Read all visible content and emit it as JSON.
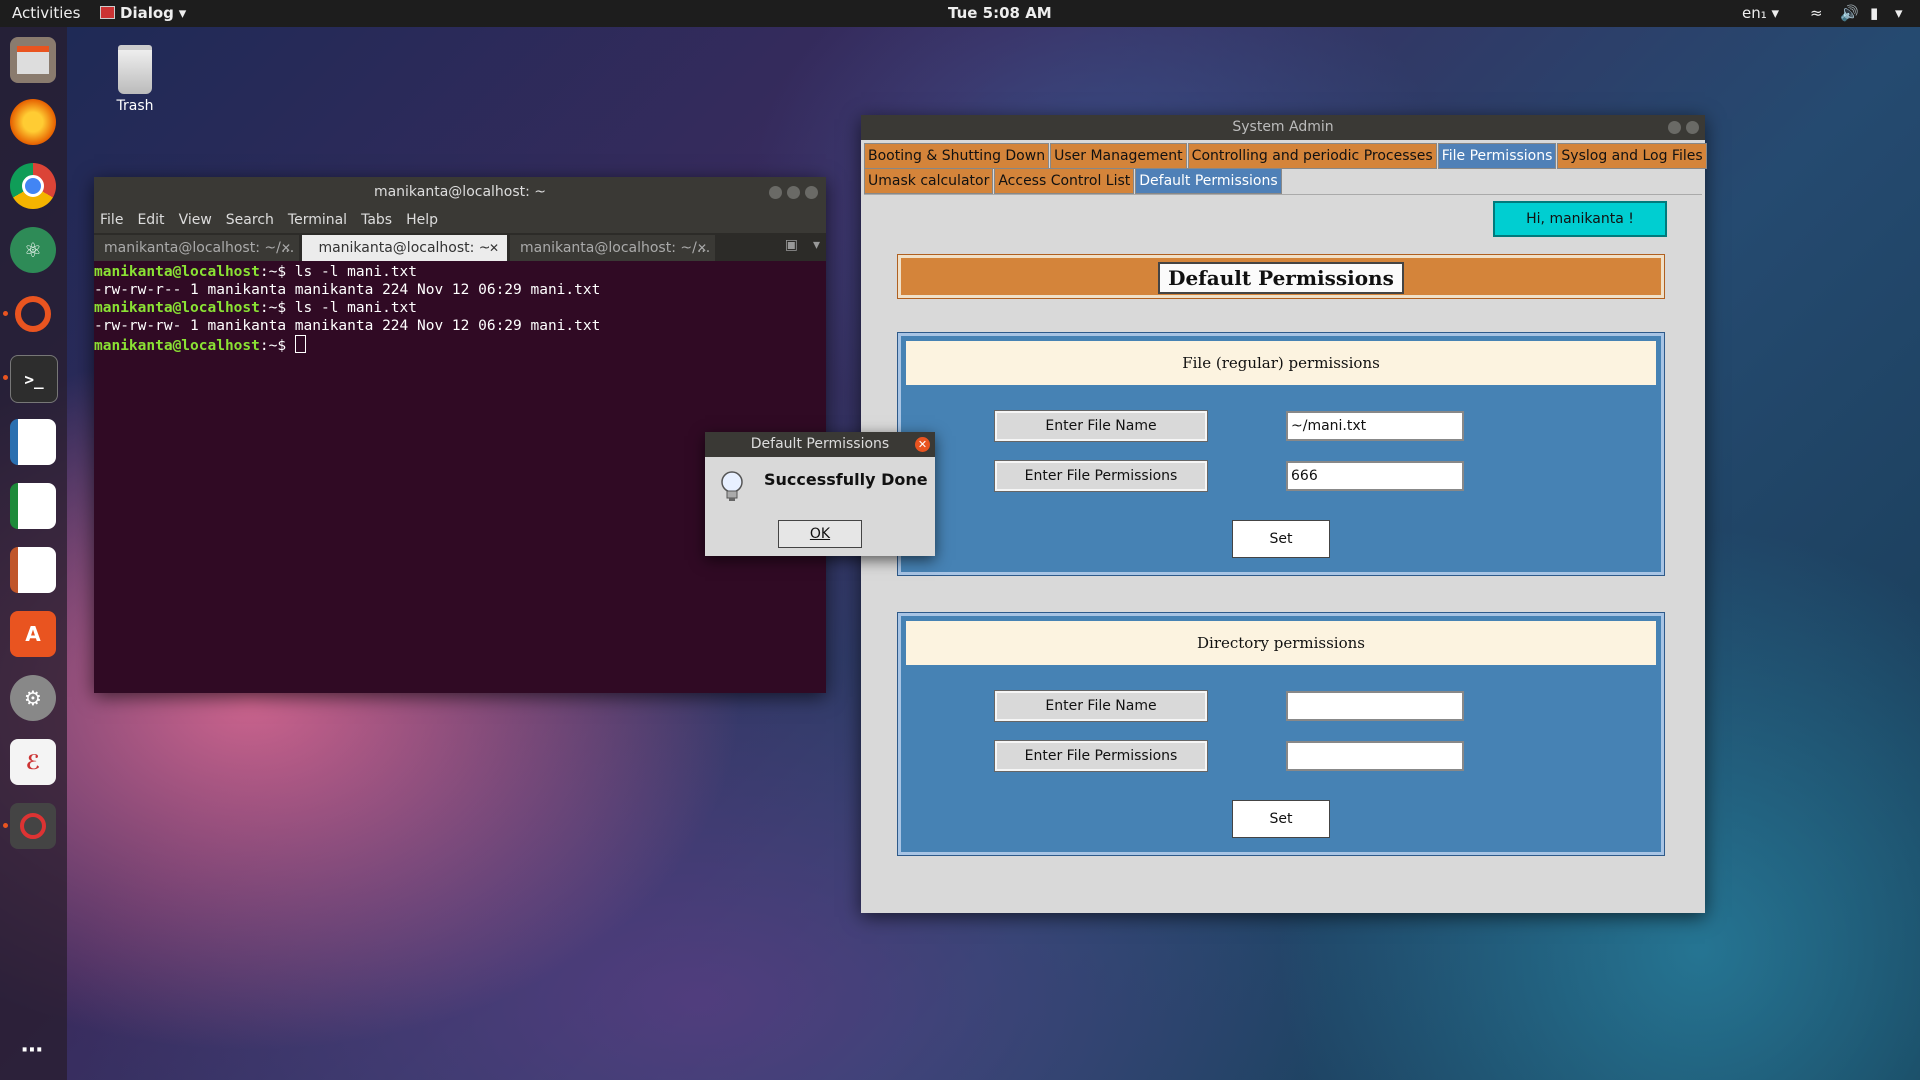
{
  "topbar": {
    "activities": "Activities",
    "app_menu": "Dialog",
    "clock": "Tue  5:08 AM",
    "lang": "en₁"
  },
  "dock": {
    "icons": [
      "files-icon",
      "firefox-icon",
      "chrome-icon",
      "atom-icon",
      "ubuntu-software-icon",
      "terminal-icon",
      "writer-icon",
      "calc-icon",
      "impress-icon",
      "app-store-icon",
      "settings-icon",
      "editor-icon",
      "blocked-icon"
    ],
    "accent": "#e95420"
  },
  "desktop": {
    "trash_label": "Trash"
  },
  "terminal": {
    "title": "manikanta@localhost: ~",
    "menu": [
      "File",
      "Edit",
      "View",
      "Search",
      "Terminal",
      "Tabs",
      "Help"
    ],
    "tabs": [
      "manikanta@localhost: ~/...",
      "manikanta@localhost: ~",
      "manikanta@localhost: ~/..."
    ],
    "lines": [
      {
        "prompt": "manikanta@localhost",
        "path": ":~$ ",
        "cmd": "ls -l mani.txt"
      },
      {
        "output": "-rw-rw-r-- 1 manikanta manikanta 224 Nov 12 06:29 mani.txt"
      },
      {
        "prompt": "manikanta@localhost",
        "path": ":~$ ",
        "cmd": "ls -l mani.txt"
      },
      {
        "output": "-rw-rw-rw- 1 manikanta manikanta 224 Nov 12 06:29 mani.txt"
      },
      {
        "prompt": "manikanta@localhost",
        "path": ":~$ ",
        "cmd": ""
      }
    ],
    "bg_color": "#300a24"
  },
  "sysadmin": {
    "title": "System Admin",
    "tabs_row1": [
      "Booting & Shutting Down",
      "User Management",
      "Controlling and periodic Processes",
      "File Permissions",
      "Syslog and Log Files"
    ],
    "tabs_row2": [
      "Umask calculator",
      "Access Control List",
      "Default Permissions"
    ],
    "greeting": "Hi, manikanta !",
    "header": "Default Permissions",
    "file_panel": {
      "title": "File (regular) permissions",
      "name_label": "Enter File Name",
      "perm_label": "Enter File Permissions",
      "name_value": "~/mani.txt",
      "perm_value": "666",
      "set_label": "Set"
    },
    "dir_panel": {
      "title": "Directory permissions",
      "name_label": "Enter File Name",
      "perm_label": "Enter File Permissions",
      "name_value": "",
      "perm_value": "",
      "set_label": "Set"
    },
    "tab_color": "#d4843a",
    "selected_tab_color": "#4f80b7",
    "panel_color": "#4682b4"
  },
  "dialog": {
    "title": "Default Permissions",
    "message": "Successfully Done",
    "ok": "OK"
  }
}
